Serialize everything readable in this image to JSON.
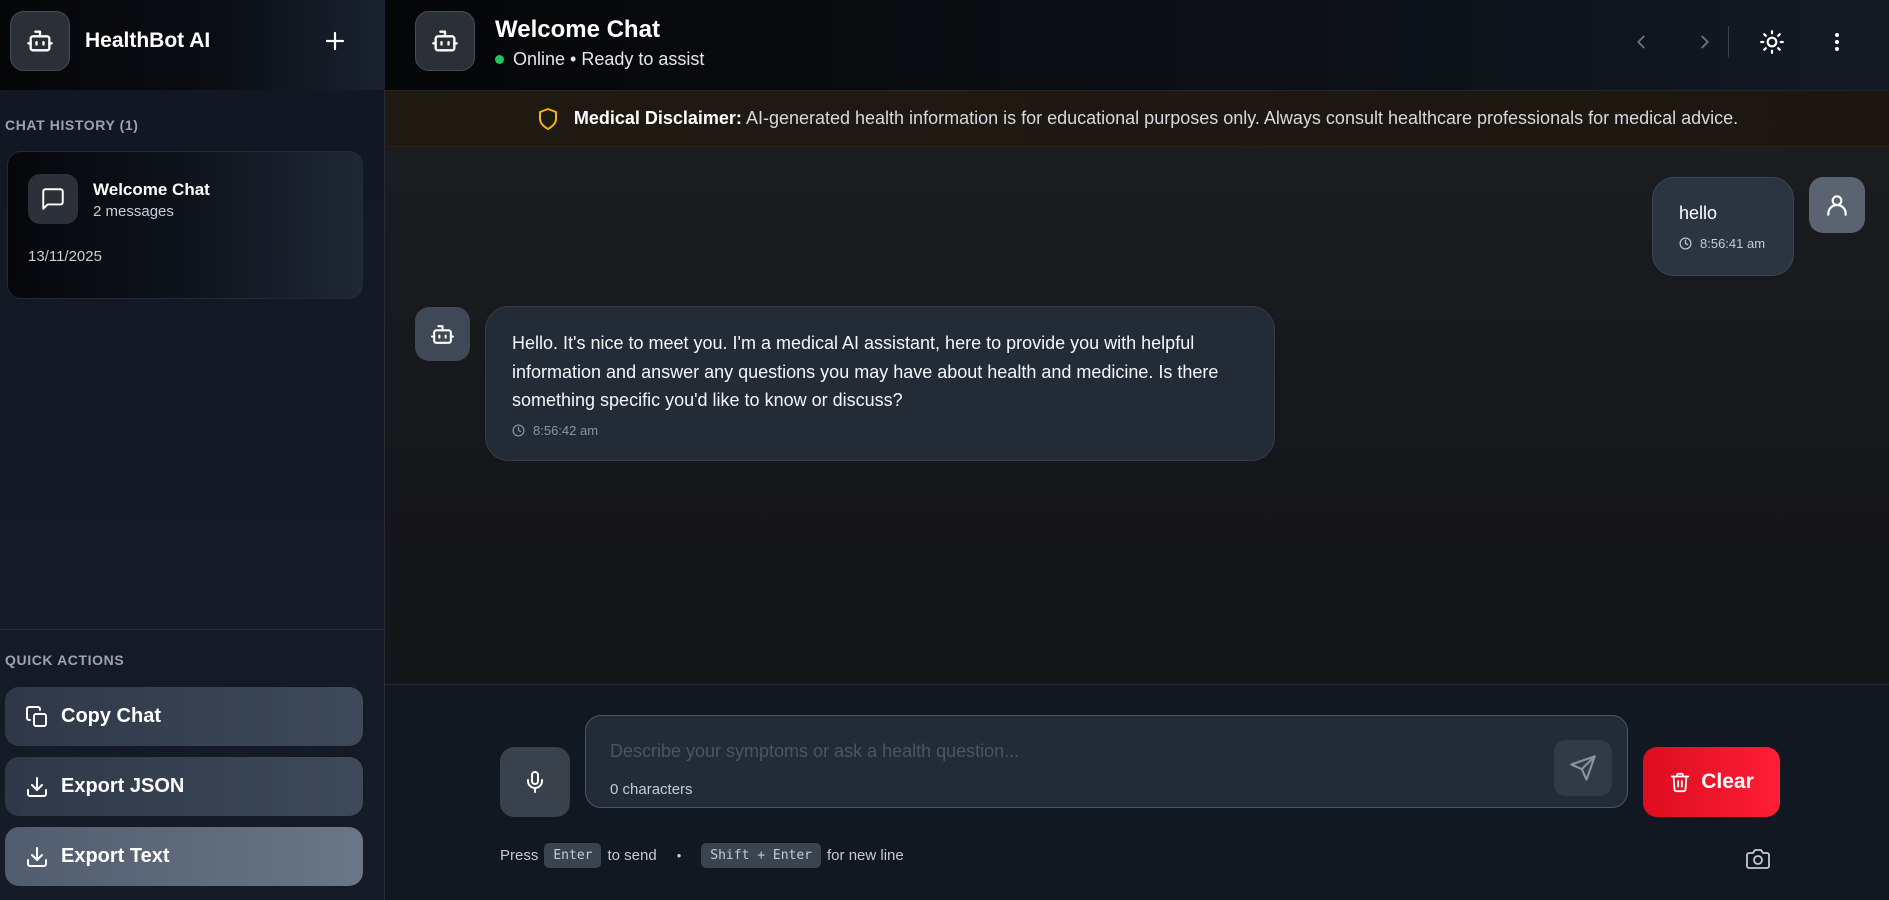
{
  "app": {
    "title": "HealthBot AI"
  },
  "sidebar": {
    "history_label": "CHAT HISTORY (1)",
    "history": [
      {
        "title": "Welcome Chat",
        "count": "2 messages",
        "date": "13/11/2025"
      }
    ],
    "quick_actions_label": "QUICK ACTIONS",
    "quick_actions": [
      {
        "label": "Copy Chat",
        "icon": "copy-icon"
      },
      {
        "label": "Export JSON",
        "icon": "download-icon"
      },
      {
        "label": "Export Text",
        "icon": "download-icon"
      }
    ]
  },
  "header": {
    "title": "Welcome Chat",
    "status": "Online • Ready to assist"
  },
  "disclaimer": {
    "label": "Medical Disclaimer:",
    "text": "AI-generated health information is for educational purposes only. Always consult healthcare professionals for medical advice."
  },
  "messages": [
    {
      "role": "user",
      "text": "hello",
      "time": "8:56:41 am"
    },
    {
      "role": "bot",
      "text": "Hello. It's nice to meet you. I'm a medical AI assistant, here to provide you with helpful information and answer any questions you may have about health and medicine. Is there something specific you'd like to know or discuss?",
      "time": "8:56:42 am"
    }
  ],
  "composer": {
    "placeholder": "Describe your symptoms or ask a health question...",
    "char_count": "0 characters",
    "clear_label": "Clear",
    "hint_press": "Press",
    "hint_enter_key": "Enter",
    "hint_to_send": "to send",
    "hint_bullet": "•",
    "hint_shift_key": "Shift + Enter",
    "hint_new_line": "for new line"
  },
  "colors": {
    "accent_red": "#ff1e36",
    "online_green": "#22c55e",
    "disclaimer_shield": "#f5b40a"
  }
}
